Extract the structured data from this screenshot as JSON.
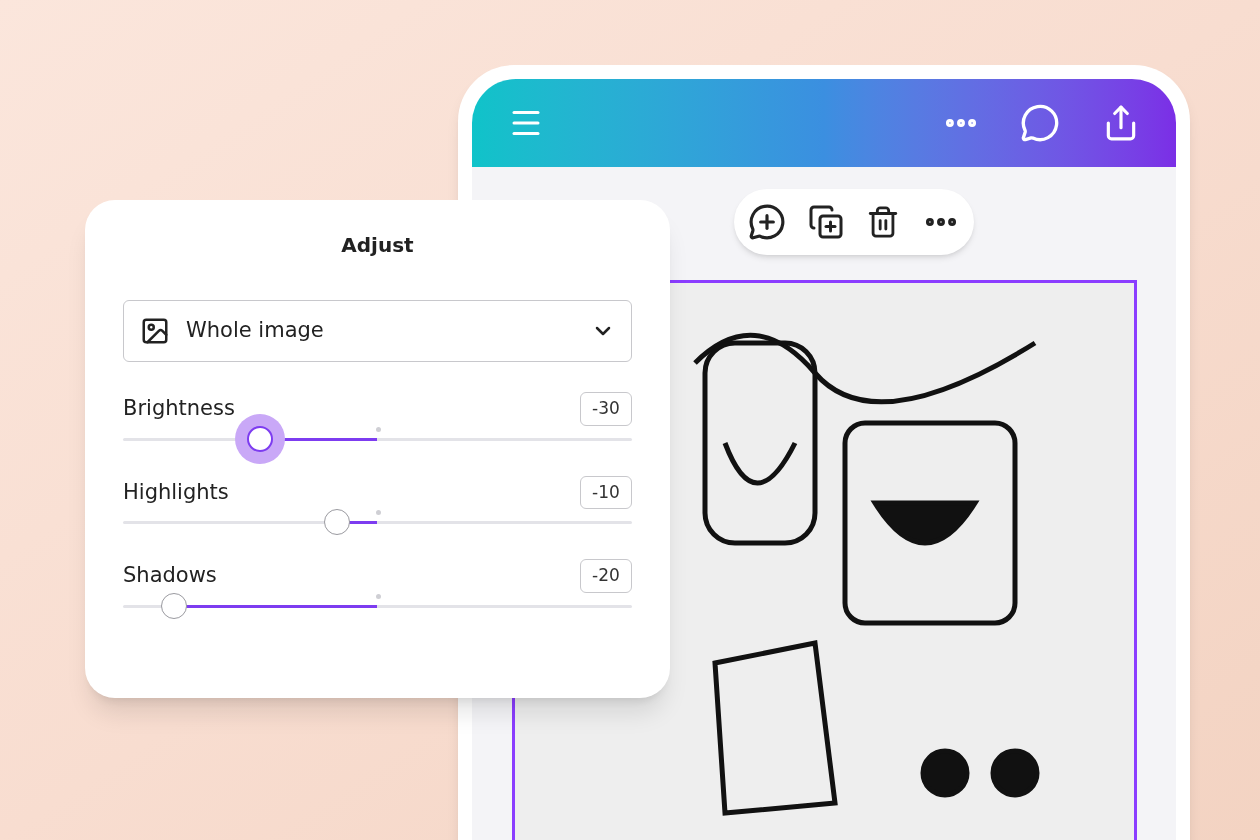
{
  "panel": {
    "title": "Adjust",
    "dropdown": {
      "value": "Whole image"
    },
    "sliders": [
      {
        "label": "Brightness",
        "reading": "-30",
        "level": 0.27,
        "focused": true
      },
      {
        "label": "Highlights",
        "reading": "-10",
        "level": 0.42,
        "focused": false
      },
      {
        "label": "Shadows",
        "reading": "-20",
        "level": 0.1,
        "focused": false
      }
    ]
  }
}
